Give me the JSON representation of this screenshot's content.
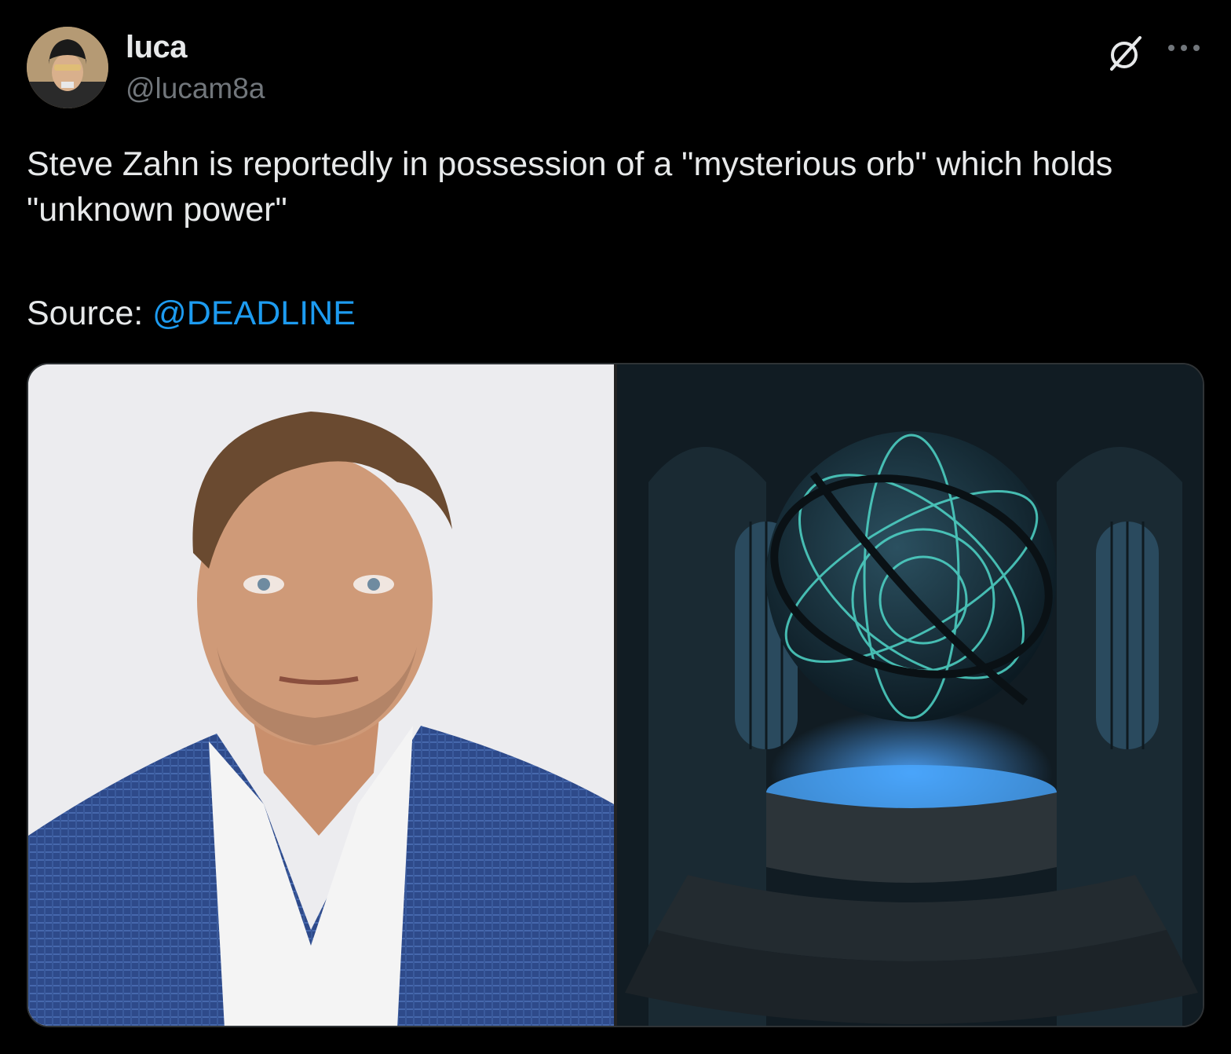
{
  "post": {
    "author": {
      "name": "luca",
      "handle": "@lucam8a"
    },
    "text": "Steve Zahn is reportedly in possession of a \"mysterious orb\" which holds \"unknown power\"",
    "source_label": "Source:",
    "source_mention": "@DEADLINE",
    "icons": {
      "grok": "grok-slash-icon",
      "more": "more-options-icon"
    },
    "media": [
      {
        "kind": "photo-portrait"
      },
      {
        "kind": "photo-glowing-orb"
      }
    ],
    "colors": {
      "background": "#000000",
      "text": "#e7e9ea",
      "secondary_text": "#71767b",
      "accent_link": "#1d9bf0"
    }
  }
}
